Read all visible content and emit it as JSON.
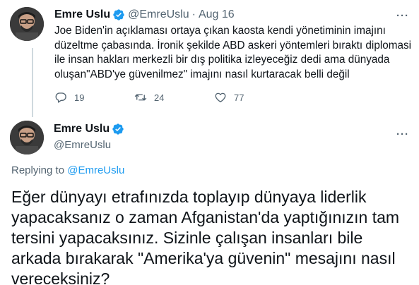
{
  "reply_tweet": {
    "author_name": "Emre Uslu",
    "author_handle": "@EmreUslu",
    "separator": "·",
    "date": "Aug 16",
    "more_label": "···",
    "text": "Joe Biden'in açıklaması ortaya çıkan kaosta kendi yönetiminin imajını düzeltme çabasında. İronik şekilde ABD askeri yöntemleri bıraktı diplomasi ile insan hakları merkezli bir dış politika izleyeceğiz dedi ama dünyada oluşan\"ABD'ye güvenilmez\" imajını nasıl kurtaracak belli değil",
    "reply_count": "19",
    "retweet_count": "24",
    "like_count": "77"
  },
  "main_tweet": {
    "author_name": "Emre Uslu",
    "author_handle": "@EmreUslu",
    "more_label": "···",
    "replying_prefix": "Replying to ",
    "replying_to": "@EmreUslu",
    "text": "Eğer dünyayı etrafınızda toplayıp dünyaya liderlik yapacaksanız o zaman Afganistan'da yaptığınızın tam tersini yapacaksınız. Sizinle çalışan insanları bile arkada bırakarak \"Amerika'ya güvenin\" mesajını nasıl vereceksiniz?"
  },
  "colors": {
    "verified": "#1d9bf0",
    "secondary_text": "#536471",
    "link": "#1d9bf0"
  }
}
